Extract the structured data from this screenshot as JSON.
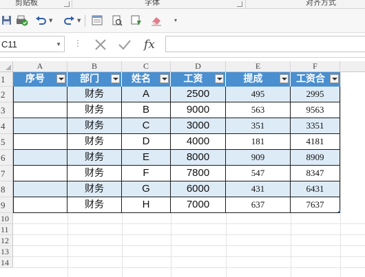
{
  "ribbon": {
    "groups": [
      {
        "label": "剪贴板"
      },
      {
        "label": "字体"
      },
      {
        "label": "对齐方式"
      }
    ]
  },
  "formula_bar": {
    "name_box": "C11",
    "cancel_icon": "close-icon",
    "enter_icon": "check-icon",
    "function_label": "fx",
    "formula_value": ""
  },
  "sheet": {
    "columns": [
      "A",
      "B",
      "C",
      "D",
      "E",
      "F"
    ],
    "rows": [
      "1",
      "2",
      "3",
      "4",
      "5",
      "6",
      "7",
      "8",
      "9",
      "10",
      "11",
      "12",
      "13",
      "14"
    ],
    "table_headers": [
      "序号",
      "部门",
      "姓名",
      "工资",
      "提成",
      "工资合"
    ],
    "table_rows": [
      [
        "",
        "财务",
        "A",
        "2500",
        "495",
        "2995"
      ],
      [
        "",
        "财务",
        "B",
        "9000",
        "563",
        "9563"
      ],
      [
        "",
        "财务",
        "C",
        "3000",
        "351",
        "3351"
      ],
      [
        "",
        "财务",
        "D",
        "4000",
        "181",
        "4181"
      ],
      [
        "",
        "财务",
        "E",
        "8000",
        "909",
        "8909"
      ],
      [
        "",
        "财务",
        "F",
        "7800",
        "547",
        "8347"
      ],
      [
        "",
        "财务",
        "G",
        "6000",
        "431",
        "6431"
      ],
      [
        "",
        "财务",
        "H",
        "7000",
        "637",
        "7637"
      ]
    ],
    "colors": {
      "header_fill": "#4a8fd0",
      "band_fill": "#ddebf7",
      "header_text": "#ffffff"
    }
  }
}
